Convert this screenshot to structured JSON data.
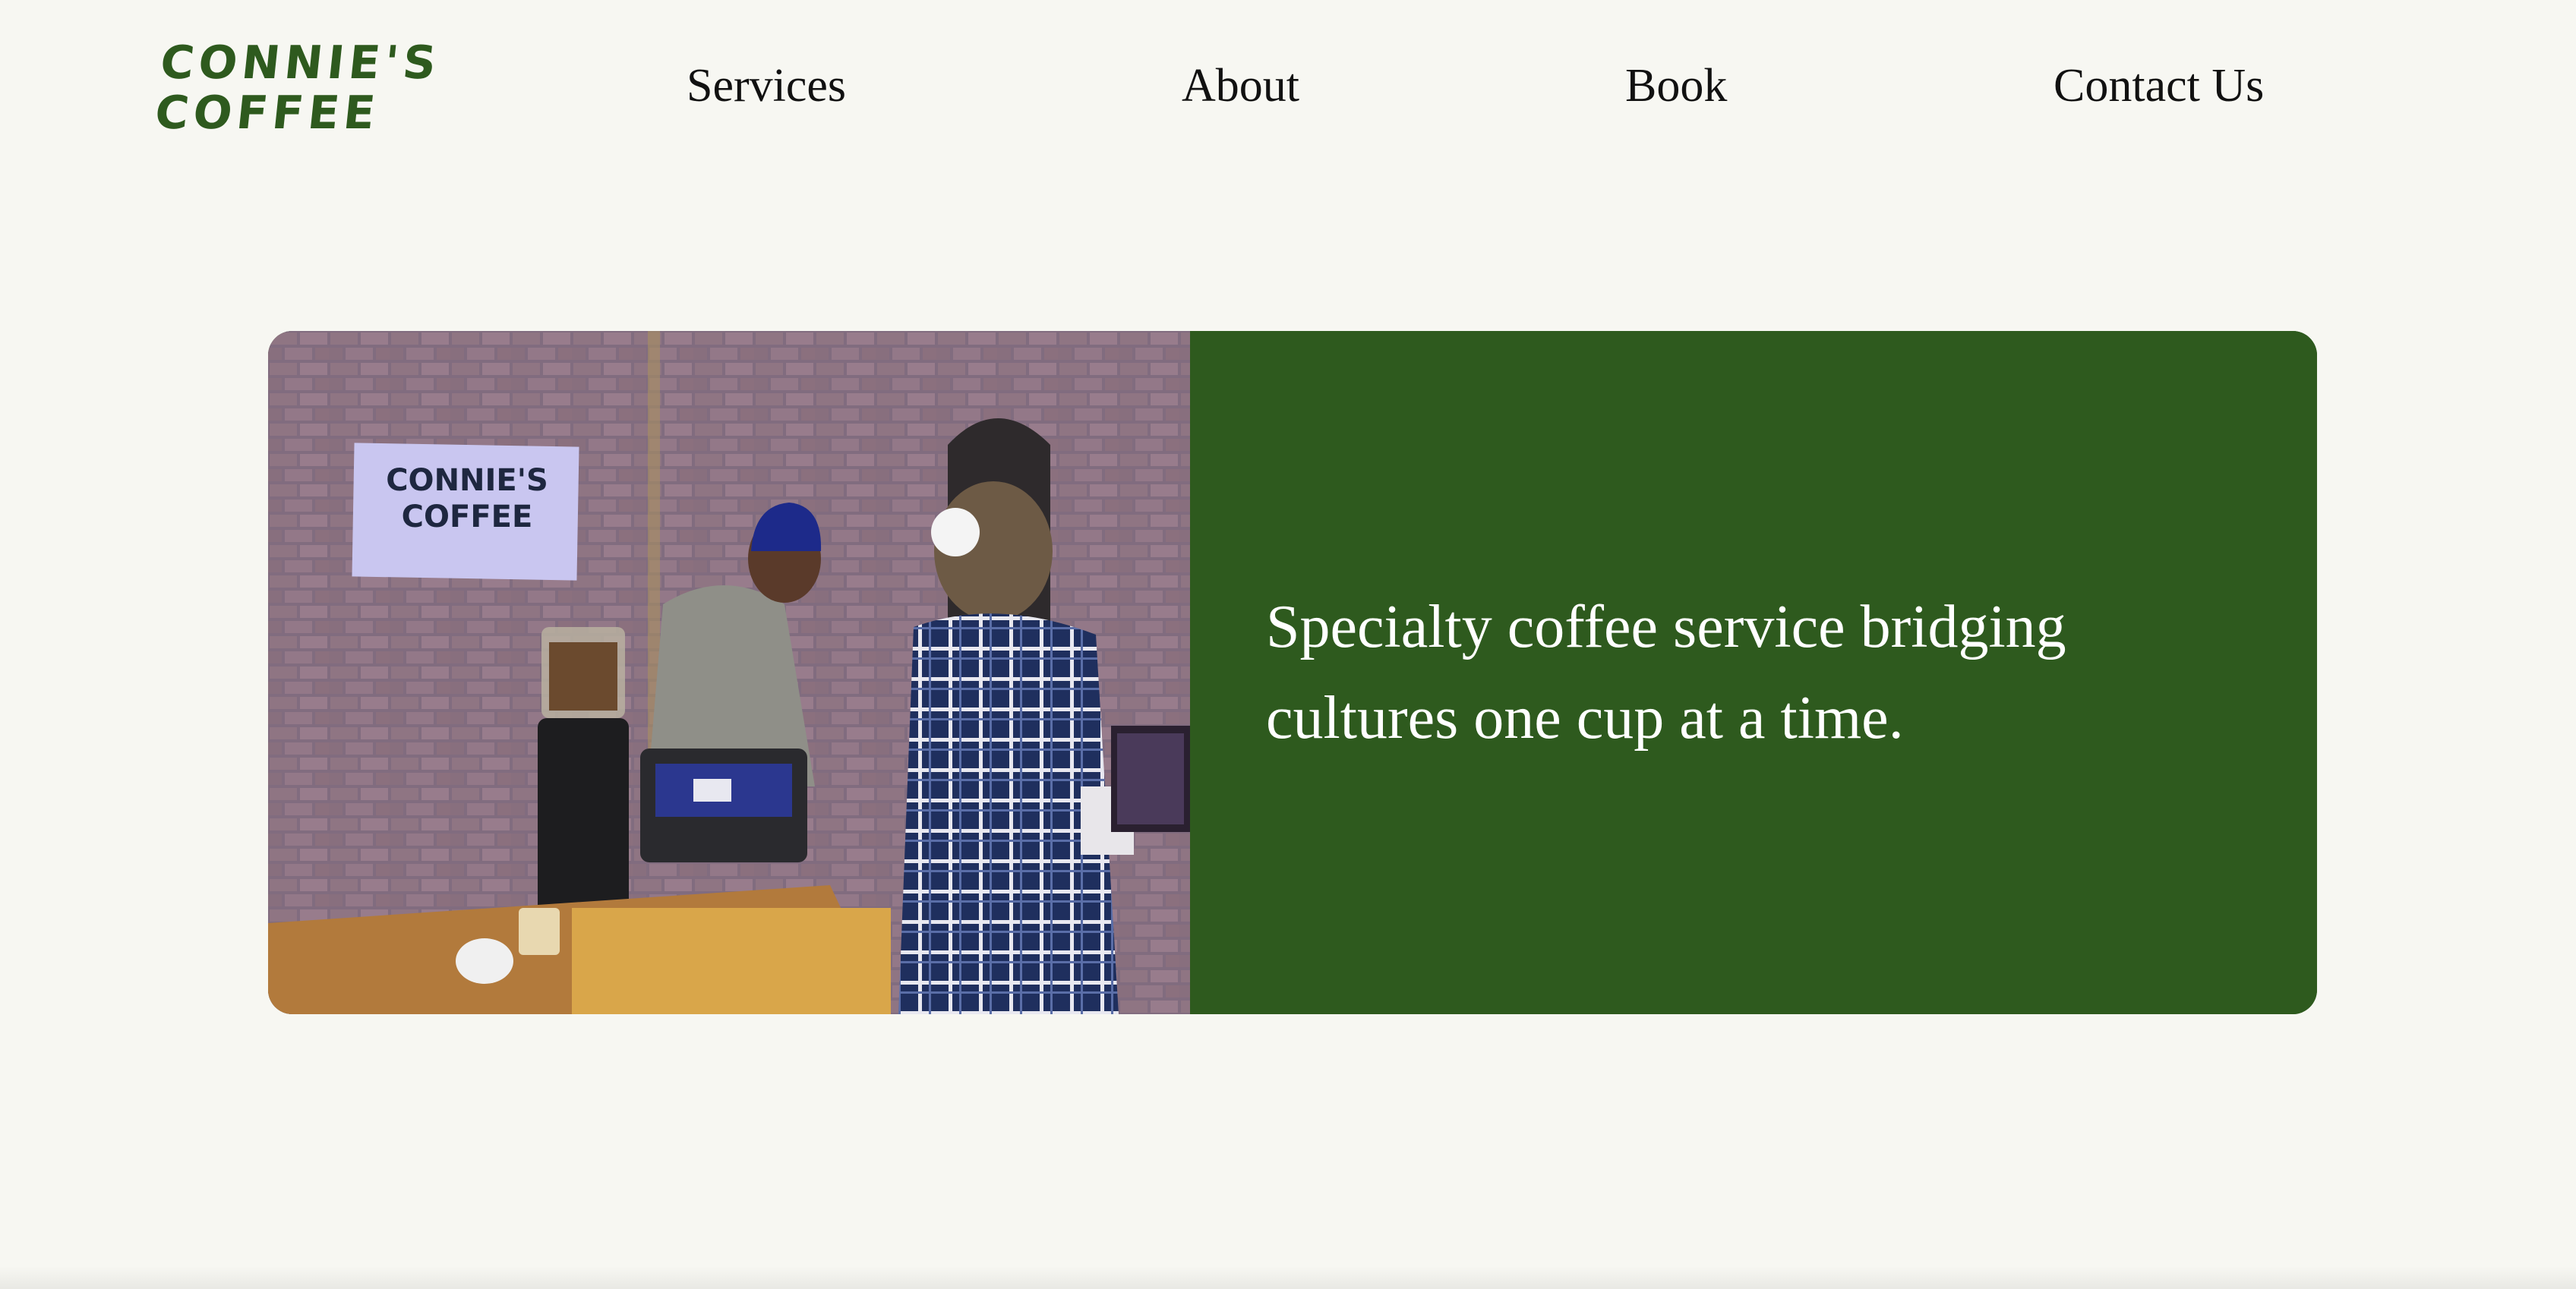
{
  "header": {
    "logo_line1": "CONNIE'S",
    "logo_line2": "COFFEE",
    "nav": {
      "services": "Services",
      "about": "About",
      "book": "Book",
      "contact": "Contact Us"
    }
  },
  "hero": {
    "tagline": "Specialty coffee service bridging cultures one cup at a time.",
    "photo": {
      "banner_line1": "CONNIE'S",
      "banner_line2": "COFFEE"
    }
  },
  "colors": {
    "background": "#f7f7f2",
    "brand_green": "#2e5a1e",
    "text": "#111111",
    "tagline_text": "#ffffff"
  }
}
